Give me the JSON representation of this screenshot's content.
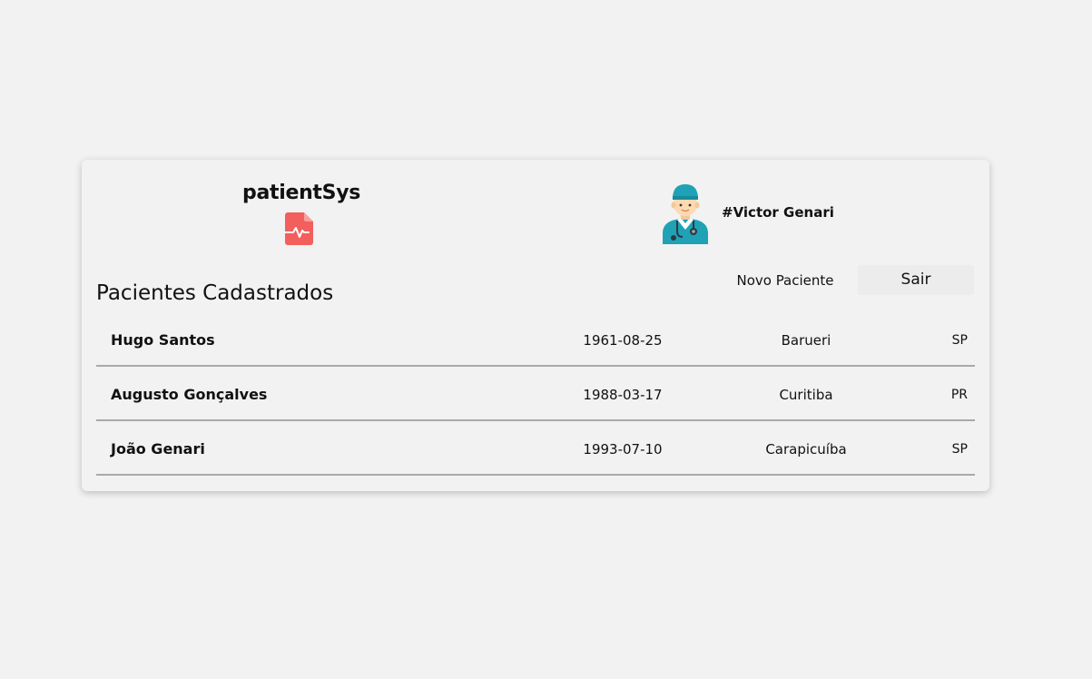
{
  "brand": {
    "title": "patientSys",
    "icon": "medical-file-icon",
    "icon_color": "#f25f5c"
  },
  "user": {
    "name": "#Victor Genari",
    "avatar": "doctor-avatar-icon"
  },
  "page": {
    "title": "Pacientes Cadastrados"
  },
  "actions": {
    "new_patient_label": "Novo Paciente",
    "exit_label": "Sair"
  },
  "patients": [
    {
      "name": "Hugo Santos",
      "birth_date": "1961-08-25",
      "city": "Barueri",
      "state": "SP"
    },
    {
      "name": "Augusto Gonçalves",
      "birth_date": "1988-03-17",
      "city": "Curitiba",
      "state": "PR"
    },
    {
      "name": "João Genari",
      "birth_date": "1993-07-10",
      "city": "Carapicuíba",
      "state": "SP"
    }
  ],
  "colors": {
    "background": "#f2f2f2",
    "divider": "#a9a9a9",
    "accent_red": "#f25f5c",
    "scrub_teal": "#1fa2b6"
  }
}
